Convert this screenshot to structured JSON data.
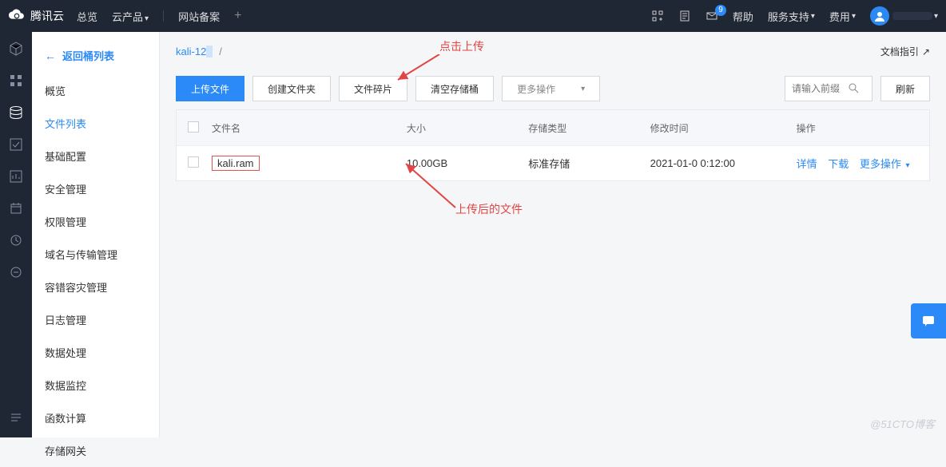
{
  "brand": "腾讯云",
  "top_nav": {
    "overview": "总览",
    "products": "云产品",
    "beian": "网站备案"
  },
  "top_right": {
    "help": "帮助",
    "service": "服务支持",
    "fee": "费用",
    "mail_badge": "9"
  },
  "sidebar": {
    "back": "返回桶列表",
    "items": [
      "概览",
      "文件列表",
      "基础配置",
      "安全管理",
      "权限管理",
      "域名与传输管理",
      "容错容灾管理",
      "日志管理",
      "数据处理",
      "数据监控",
      "函数计算",
      "存储网关"
    ]
  },
  "breadcrumb": {
    "bucket": "kali-12",
    "suffix": "",
    "sep": "/"
  },
  "doc_link": "文档指引",
  "toolbar": {
    "upload": "上传文件",
    "mkdir": "创建文件夹",
    "fragment": "文件碎片",
    "empty": "清空存储桶",
    "more": "更多操作",
    "refresh": "刷新",
    "search_placeholder": "请输入前缀"
  },
  "table": {
    "headers": {
      "name": "文件名",
      "size": "大小",
      "type": "存储类型",
      "time": "修改时间",
      "ops": "操作"
    },
    "row": {
      "name": "kali.ram",
      "size": "10.00GB",
      "type": "标准存储",
      "time": "2021-01-0   0:12:00",
      "detail": "详情",
      "download": "下载",
      "more": "更多操作"
    }
  },
  "annotations": {
    "click_upload": "点击上传",
    "after_upload": "上传后的文件"
  },
  "watermark": "@51CTO博客"
}
